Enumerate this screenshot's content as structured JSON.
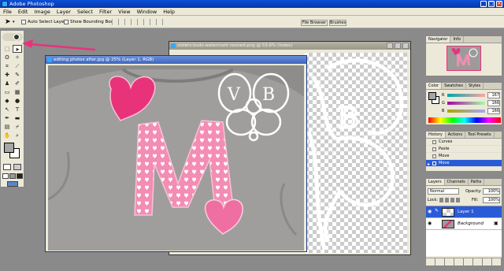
{
  "app": {
    "title": "Adobe Photoshop"
  },
  "menu": [
    "File",
    "Edit",
    "Image",
    "Layer",
    "Select",
    "Filter",
    "View",
    "Window",
    "Help"
  ],
  "options": {
    "auto_select": "Auto Select Layer",
    "bounding_box": "Show Bounding Box"
  },
  "palette_well": [
    "File Browser",
    "Brushes"
  ],
  "doc_back": {
    "title": "violets-buds-watermark resized.png @ 53.6% (Index)"
  },
  "doc_front": {
    "title": "editing photos after.jpg @ 25% (Layer 1, RGB)"
  },
  "watermark": {
    "letter_left": "V",
    "letter_right": "B"
  },
  "navigator": {
    "tabs": [
      "Navigator",
      "Info"
    ]
  },
  "color": {
    "tabs": [
      "Color",
      "Swatches",
      "Styles"
    ],
    "sliders": [
      {
        "label": "R",
        "value": "167"
      },
      {
        "label": "G",
        "value": "166"
      },
      {
        "label": "B",
        "value": "166"
      }
    ]
  },
  "history": {
    "tabs": [
      "History",
      "Actions",
      "Tool Presets"
    ],
    "items": [
      "Curves",
      "Paste",
      "Move",
      "Move"
    ]
  },
  "layers": {
    "tabs": [
      "Layers",
      "Channels",
      "Paths"
    ],
    "blend_mode": "Normal",
    "opacity_label": "Opacity:",
    "opacity_value": "100%",
    "lock_label": "Lock:",
    "fill_label": "Fill:",
    "fill_value": "100%",
    "items": [
      "Layer 1",
      "Background"
    ]
  },
  "colors": {
    "accent_pink": "#e8337a",
    "selection_blue": "#2a5bd6",
    "canvas_gray": "#8a8a8a"
  }
}
